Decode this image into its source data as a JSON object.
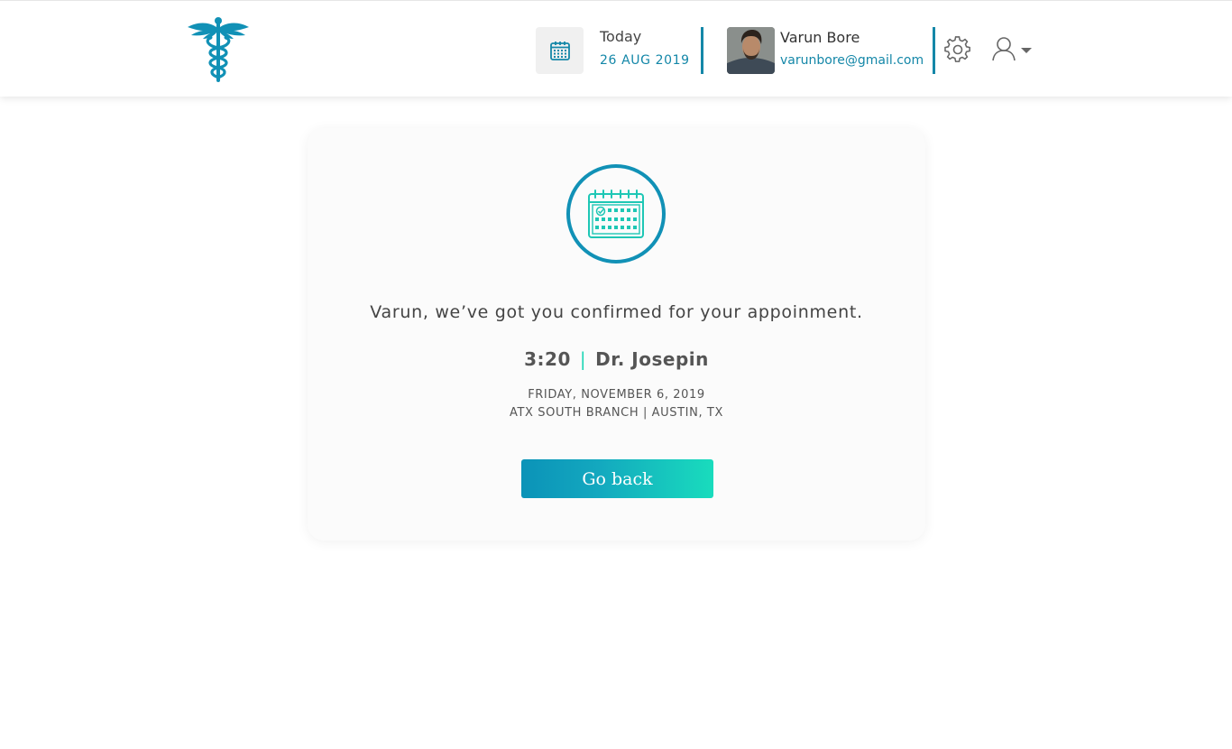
{
  "header": {
    "logo_icon": "caduceus-icon",
    "calendar_icon": "calendar-icon",
    "today_label": "Today",
    "today_date": "26 AUG 2019",
    "user": {
      "name": "Varun Bore",
      "email": "varunbore@gmail.com"
    },
    "settings_icon": "gear-icon",
    "user_menu_icon": "user-icon",
    "accent_color": "#1487a8"
  },
  "confirmation": {
    "icon": "calendar-check-icon",
    "message": "Varun, we’ve got you confirmed for your appoinment.",
    "time": "3:20",
    "separator": "|",
    "doctor": "Dr. Josepin",
    "date": "FRIDAY, NOVEMBER 6, 2019",
    "location": "ATX SOUTH BRANCH | AUSTIN, TX",
    "button_label": "Go back",
    "button_gradient": [
      "#0b93b8",
      "#19dcbd"
    ]
  }
}
